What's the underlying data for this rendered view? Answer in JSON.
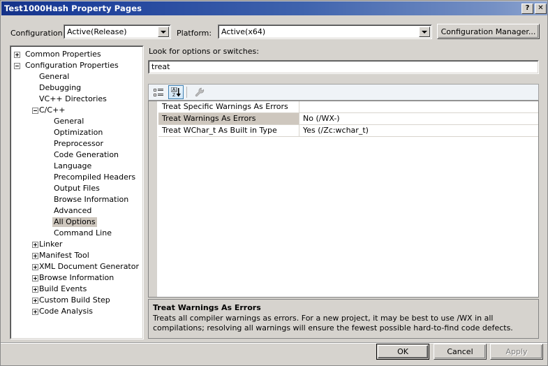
{
  "window": {
    "title": "Test1000Hash Property Pages",
    "help_button": "?",
    "close_button": "✕"
  },
  "toolbar_row": {
    "configuration_label": "Configuration:",
    "configuration_value": "Active(Release)",
    "platform_label": "Platform:",
    "platform_value": "Active(x64)",
    "configuration_manager_label": "Configuration Manager..."
  },
  "tree": {
    "items": [
      {
        "label": "Common Properties",
        "indent": 0,
        "toggle": "plus",
        "selected": false
      },
      {
        "label": "Configuration Properties",
        "indent": 0,
        "toggle": "minus",
        "selected": false
      },
      {
        "label": "General",
        "indent": 1,
        "toggle": "none",
        "selected": false
      },
      {
        "label": "Debugging",
        "indent": 1,
        "toggle": "none",
        "selected": false
      },
      {
        "label": "VC++ Directories",
        "indent": 1,
        "toggle": "none",
        "selected": false
      },
      {
        "label": "C/C++",
        "indent": 1,
        "toggle": "minus",
        "selected": false
      },
      {
        "label": "General",
        "indent": 2,
        "toggle": "none",
        "selected": false
      },
      {
        "label": "Optimization",
        "indent": 2,
        "toggle": "none",
        "selected": false
      },
      {
        "label": "Preprocessor",
        "indent": 2,
        "toggle": "none",
        "selected": false
      },
      {
        "label": "Code Generation",
        "indent": 2,
        "toggle": "none",
        "selected": false
      },
      {
        "label": "Language",
        "indent": 2,
        "toggle": "none",
        "selected": false
      },
      {
        "label": "Precompiled Headers",
        "indent": 2,
        "toggle": "none",
        "selected": false
      },
      {
        "label": "Output Files",
        "indent": 2,
        "toggle": "none",
        "selected": false
      },
      {
        "label": "Browse Information",
        "indent": 2,
        "toggle": "none",
        "selected": false
      },
      {
        "label": "Advanced",
        "indent": 2,
        "toggle": "none",
        "selected": false
      },
      {
        "label": "All Options",
        "indent": 2,
        "toggle": "none",
        "selected": true
      },
      {
        "label": "Command Line",
        "indent": 2,
        "toggle": "none",
        "selected": false
      },
      {
        "label": "Linker",
        "indent": 1,
        "toggle": "plus",
        "selected": false
      },
      {
        "label": "Manifest Tool",
        "indent": 1,
        "toggle": "plus",
        "selected": false
      },
      {
        "label": "XML Document Generator",
        "indent": 1,
        "toggle": "plus",
        "selected": false
      },
      {
        "label": "Browse Information",
        "indent": 1,
        "toggle": "plus",
        "selected": false
      },
      {
        "label": "Build Events",
        "indent": 1,
        "toggle": "plus",
        "selected": false
      },
      {
        "label": "Custom Build Step",
        "indent": 1,
        "toggle": "plus",
        "selected": false
      },
      {
        "label": "Code Analysis",
        "indent": 1,
        "toggle": "plus",
        "selected": false
      }
    ]
  },
  "search": {
    "label": "Look for options or switches:",
    "value": "treat",
    "placeholder": ""
  },
  "grid_toolbar": {
    "buttons": [
      {
        "icon": "categorized-view-icon",
        "active": false,
        "enabled": true
      },
      {
        "icon": "alphabetical-sort-icon",
        "active": true,
        "enabled": true
      },
      {
        "icon": "property-pages-wrench-icon",
        "active": false,
        "enabled": false
      }
    ]
  },
  "grid": {
    "rows": [
      {
        "name": "Treat Specific Warnings As Errors",
        "value": "",
        "selected": false
      },
      {
        "name": "Treat Warnings As Errors",
        "value": "No (/WX-)",
        "selected": true
      },
      {
        "name": "Treat WChar_t As Built in Type",
        "value": "Yes (/Zc:wchar_t)",
        "selected": false
      }
    ]
  },
  "description": {
    "title": "Treat Warnings As Errors",
    "body": "Treats all compiler warnings as errors. For a new project, it may be best to use /WX in all compilations; resolving all warnings will ensure the fewest possible hard-to-find code defects."
  },
  "footer": {
    "ok_label": "OK",
    "cancel_label": "Cancel",
    "apply_label": "Apply"
  },
  "colors": {
    "dialog_face": "#d6d3ce",
    "title_gradient_start": "#153288",
    "title_gradient_end": "#8da5d0",
    "selection_gray": "#cec7be",
    "toolbar_active_border": "#3c7fb1"
  }
}
